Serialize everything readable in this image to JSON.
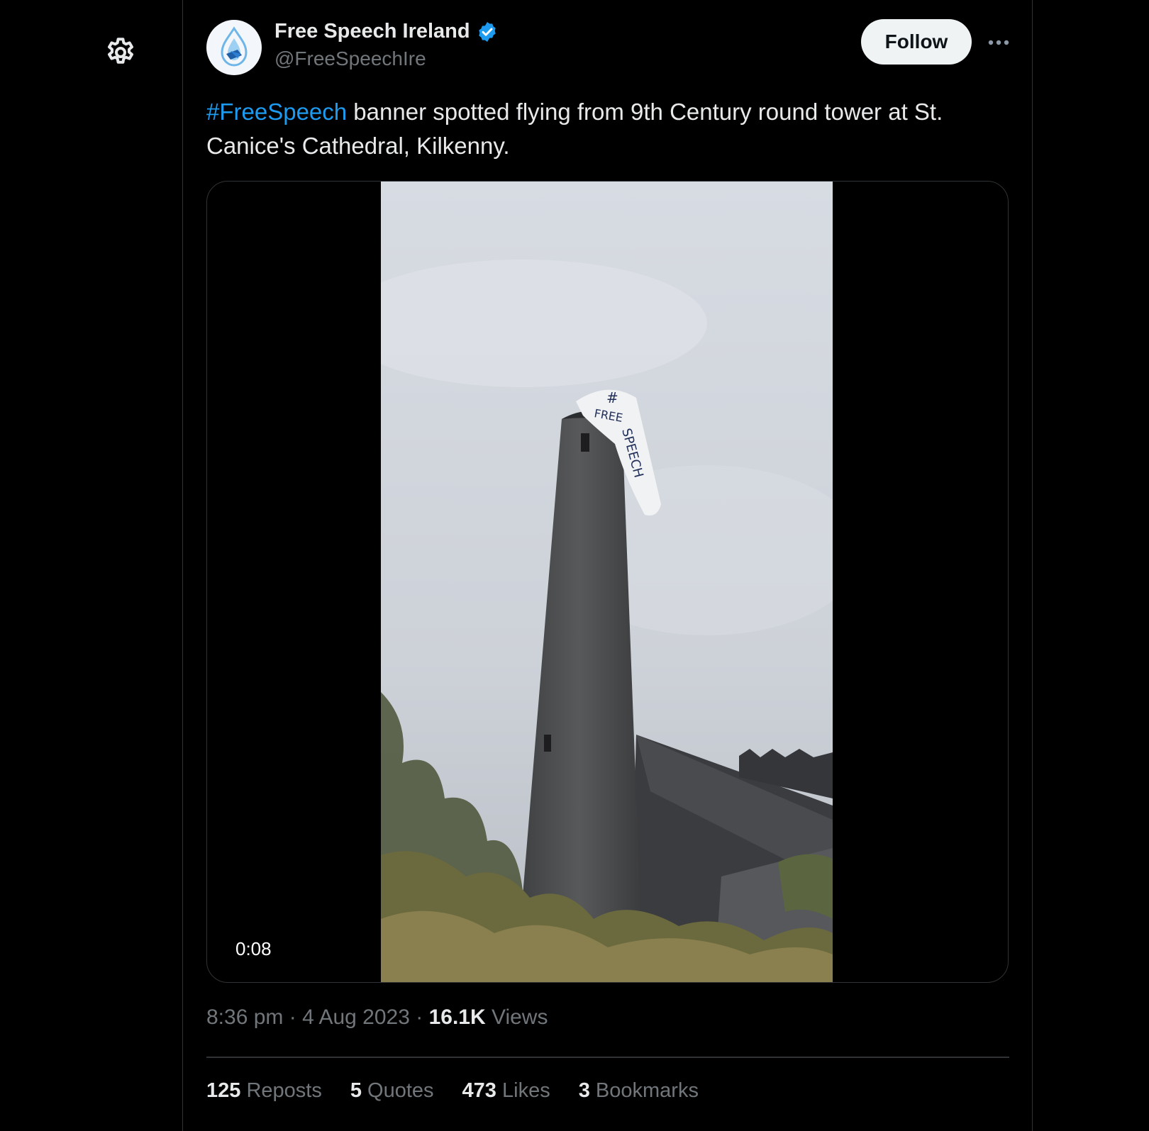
{
  "sidebar": {
    "settings_icon": "gear-icon"
  },
  "tweet": {
    "author": {
      "display_name": "Free Speech Ireland",
      "handle": "@FreeSpeechIre",
      "verified_icon": "verified-badge-icon",
      "verified_color": "#1d9bf0"
    },
    "follow_label": "Follow",
    "more_icon": "more-dots-icon",
    "text": {
      "hashtag": "#FreeSpeech",
      "body": " banner spotted flying from 9th Century round tower at St. Canice's Cathedral, Kilkenny."
    },
    "media": {
      "duration": "0:08",
      "banner_text_line1": "#",
      "banner_text_line2": "FREE",
      "banner_text_line3": "SPEECH"
    },
    "meta": {
      "time": "8:36 pm",
      "date": "4 Aug 2023",
      "views_count": "16.1K",
      "views_label": "Views"
    },
    "stats": {
      "reposts_count": "125",
      "reposts_label": "Reposts",
      "quotes_count": "5",
      "quotes_label": "Quotes",
      "likes_count": "473",
      "likes_label": "Likes",
      "bookmarks_count": "3",
      "bookmarks_label": "Bookmarks"
    }
  },
  "colors": {
    "background": "#000000",
    "accent": "#1d9bf0",
    "text_primary": "#e7e9ea",
    "text_secondary": "#71767b",
    "border": "#2f3336"
  }
}
